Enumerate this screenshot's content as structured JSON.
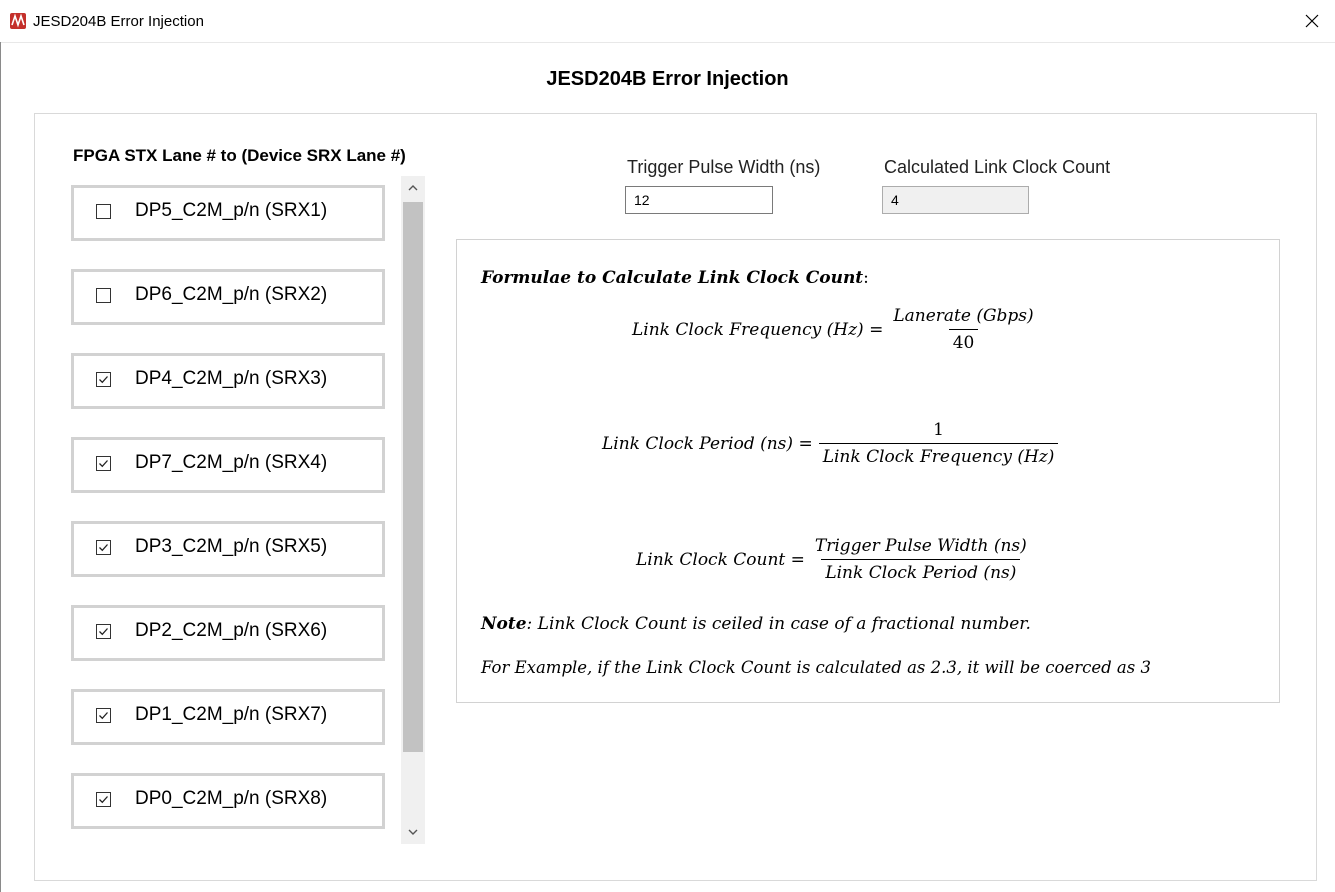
{
  "window": {
    "title": "JESD204B Error Injection",
    "close_glyph": "✕",
    "icon": "app-logo-icon"
  },
  "heading": "JESD204B Error Injection",
  "lanes": {
    "title": "FPGA STX Lane # to (Device SRX Lane #)",
    "items": [
      {
        "label": "DP5_C2M_p/n (SRX1)",
        "checked": false
      },
      {
        "label": "DP6_C2M_p/n (SRX2)",
        "checked": false
      },
      {
        "label": "DP4_C2M_p/n (SRX3)",
        "checked": true
      },
      {
        "label": "DP7_C2M_p/n (SRX4)",
        "checked": true
      },
      {
        "label": "DP3_C2M_p/n (SRX5)",
        "checked": true
      },
      {
        "label": "DP2_C2M_p/n (SRX6)",
        "checked": true
      },
      {
        "label": "DP1_C2M_p/n (SRX7)",
        "checked": true
      },
      {
        "label": "DP0_C2M_p/n (SRX8)",
        "checked": true
      }
    ]
  },
  "trigger": {
    "label": "Trigger Pulse Width (ns)",
    "value": "12"
  },
  "link_clock_count": {
    "label": "Calculated Link Clock Count",
    "value": "4"
  },
  "formulae": {
    "title": "Formulae to Calculate Link Clock Count",
    "title_suffix": ":",
    "eq1": {
      "lhs": "Link Clock Frequency (Hz) =",
      "num": "Lanerate (Gbps)",
      "den": "40"
    },
    "eq2": {
      "lhs": "Link Clock Period (ns) =",
      "num": "1",
      "den": "Link Clock Frequency (Hz)"
    },
    "eq3": {
      "lhs": "Link Clock Count =",
      "num": "Trigger Pulse Width (ns)",
      "den": "Link Clock Period (ns)"
    },
    "note_label": "Note",
    "note_text": ": Link Clock Count is ceiled in case of a fractional number.",
    "example": "For Example, if the Link Clock Count is calculated as 2.3, it will be coerced as 3"
  },
  "colors": {
    "accent_icon": "#c4302b",
    "lane_border": "#d2d2d2"
  }
}
